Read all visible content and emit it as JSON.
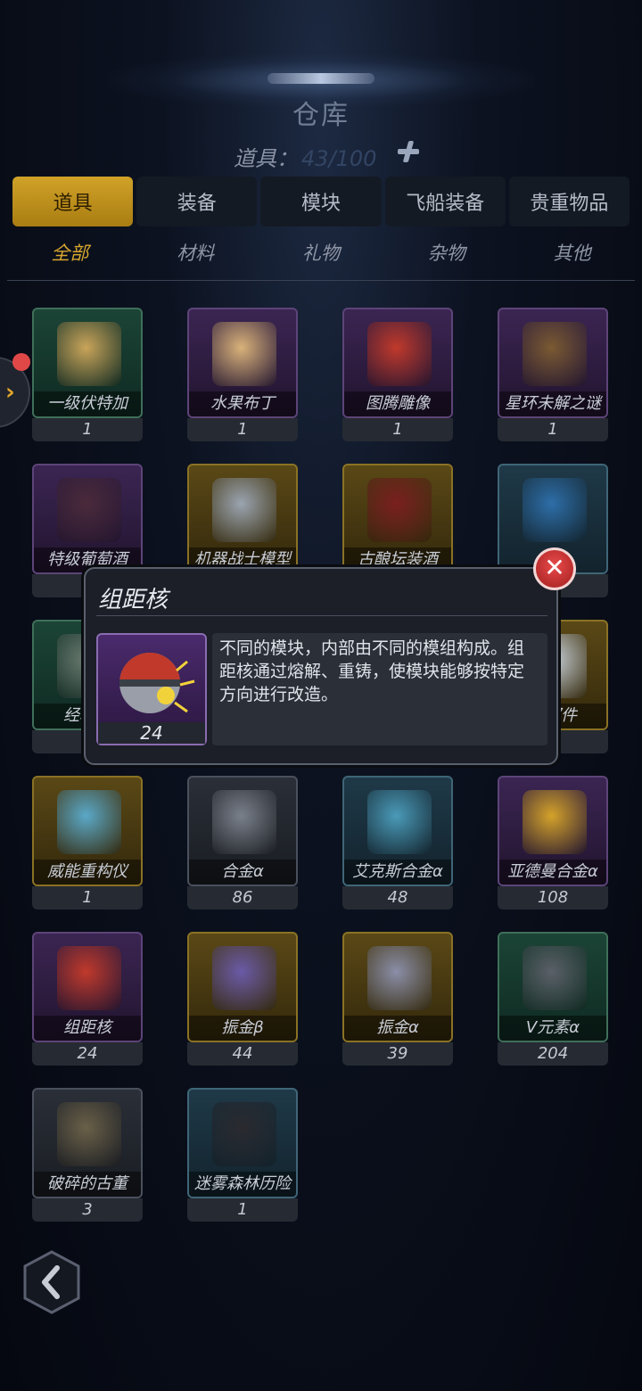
{
  "header": {
    "title": "仓库",
    "capacity_label": "道具：",
    "capacity_value": "43/100"
  },
  "tabs": [
    {
      "label": "道具",
      "active": true
    },
    {
      "label": "装备"
    },
    {
      "label": "模块"
    },
    {
      "label": "飞船装备"
    },
    {
      "label": "贵重物品"
    }
  ],
  "subtabs": [
    {
      "label": "全部",
      "active": true
    },
    {
      "label": "材料"
    },
    {
      "label": "礼物"
    },
    {
      "label": "杂物"
    },
    {
      "label": "其他"
    }
  ],
  "items": [
    {
      "name": "一级伏特加",
      "count": "1",
      "rarity": "green",
      "art": "#c9a45a"
    },
    {
      "name": "水果布丁",
      "count": "1",
      "rarity": "purple",
      "art": "#d9b27a"
    },
    {
      "name": "图腾雕像",
      "count": "1",
      "rarity": "purple",
      "art": "#c0392b"
    },
    {
      "name": "星环未解之谜",
      "count": "1",
      "rarity": "purple",
      "art": "#7a5a32"
    },
    {
      "name": "特级葡萄酒",
      "count": "",
      "rarity": "purple",
      "art": "#4a2a3a"
    },
    {
      "name": "机器战士模型",
      "count": "",
      "rarity": "gold",
      "art": "#9aa4b0"
    },
    {
      "name": "古酿坛装酒",
      "count": "",
      "rarity": "gold",
      "art": "#7a1f1f"
    },
    {
      "name": "",
      "count": "",
      "rarity": "blue",
      "art": "#2d6ea8"
    },
    {
      "name": "经验药",
      "count": "",
      "rarity": "green",
      "art": "#6a7a70"
    },
    {
      "name": "",
      "count": "",
      "rarity": "gray",
      "art": "#3a3f48"
    },
    {
      "name": "",
      "count": "",
      "rarity": "gray",
      "art": "#3a3f48"
    },
    {
      "name": "具部件",
      "count": "",
      "rarity": "gold",
      "art": "#c9d2dc"
    },
    {
      "name": "威能重构仪",
      "count": "1",
      "rarity": "gold",
      "art": "#5aa8c8"
    },
    {
      "name": "合金α",
      "count": "86",
      "rarity": "gray",
      "art": "#7a808a"
    },
    {
      "name": "艾克斯合金α",
      "count": "48",
      "rarity": "blue",
      "art": "#4a9ab8"
    },
    {
      "name": "亚德曼合金α",
      "count": "108",
      "rarity": "purple",
      "art": "#d4a22a"
    },
    {
      "name": "组距核",
      "count": "24",
      "rarity": "purple",
      "art": "#c0392b"
    },
    {
      "name": "振金β",
      "count": "44",
      "rarity": "gold",
      "art": "#6a5aa8"
    },
    {
      "name": "振金α",
      "count": "39",
      "rarity": "gold",
      "art": "#8a8ea8"
    },
    {
      "name": "V元素α",
      "count": "204",
      "rarity": "green",
      "art": "#5a6068"
    },
    {
      "name": "破碎的古董",
      "count": "3",
      "rarity": "gray",
      "art": "#6a6048"
    },
    {
      "name": "迷雾森林历险",
      "count": "1",
      "rarity": "blue",
      "art": "#2a2a30"
    }
  ],
  "popup": {
    "title": "组距核",
    "count": "24",
    "description": "不同的模块，内部由不同的模组构成。组距核通过熔解、重铸，使模块能够按特定方向进行改造。",
    "close_label": "✕"
  },
  "colors": {
    "accent": "#d0a228",
    "badge": "#e04848"
  },
  "icons": {
    "back": "chevron-left-icon",
    "side": "chevron-right-icon",
    "capacity": "plus-icon"
  }
}
